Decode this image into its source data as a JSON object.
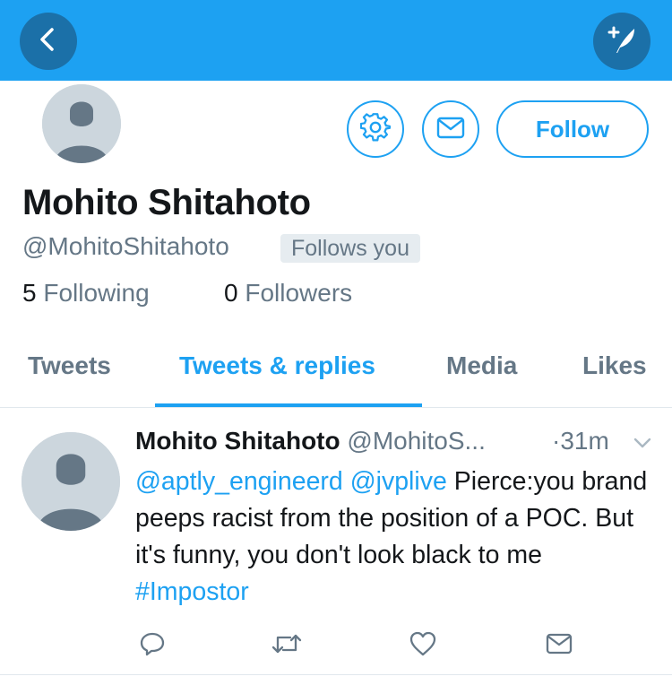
{
  "header": {
    "back_icon": "chevron-left-icon",
    "compose_icon": "compose-tweet-icon"
  },
  "profile": {
    "display_name": "Mohito Shitahoto",
    "handle": "@MohitoShitahoto",
    "follows_you_badge": "Follows you",
    "following_count": "5",
    "following_label": "Following",
    "followers_count": "0",
    "followers_label": "Followers",
    "follow_button_label": "Follow",
    "settings_icon": "gear-icon",
    "message_icon": "envelope-icon"
  },
  "tabs": [
    {
      "label": "Tweets",
      "active": false
    },
    {
      "label": "Tweets & replies",
      "active": true
    },
    {
      "label": "Media",
      "active": false
    },
    {
      "label": "Likes",
      "active": false
    }
  ],
  "tweet": {
    "name": "Mohito Shitahoto",
    "handle": "@MohitoS...",
    "time_prefix": "·",
    "time": "31m",
    "mention_1": "@aptly_engineerd",
    "mention_2": "@jvplive",
    "text_part_1": "Pierce:you brand peeps racist from the position of a POC. But it's funny, you don't look black to me",
    "hashtag": "#Impostor",
    "actions": [
      "reply-icon",
      "retweet-icon",
      "like-icon",
      "direct-message-icon"
    ]
  },
  "colors": {
    "brand_blue": "#1da1f2",
    "header_button": "#1b70a8",
    "secondary_text": "#657786",
    "avatar_placeholder": "#ccd6dd"
  }
}
